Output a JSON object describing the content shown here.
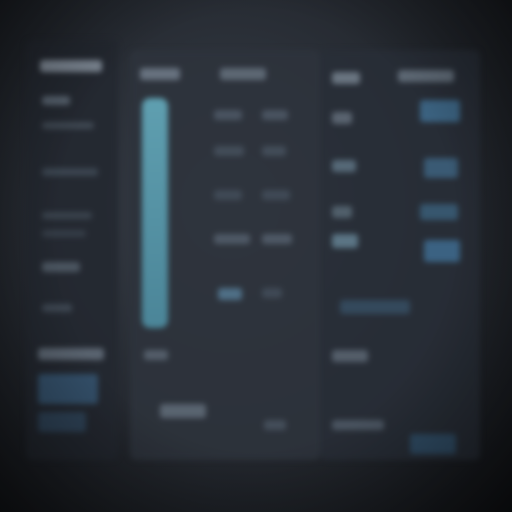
{
  "screen": {
    "description_visible_text": false
  },
  "sidebar": {
    "items_count_visible": 8
  },
  "main": {
    "has_highlighted_column": true,
    "accent": "#6fb3c0"
  },
  "right_panel": {
    "accent": "#5a8fb0"
  },
  "colors": {
    "bg": "#23272e",
    "panel": "#2b3038",
    "text_dim": "#6f7a86",
    "accent_teal": "#6fb3c0",
    "accent_blue": "#4c7ea0"
  }
}
